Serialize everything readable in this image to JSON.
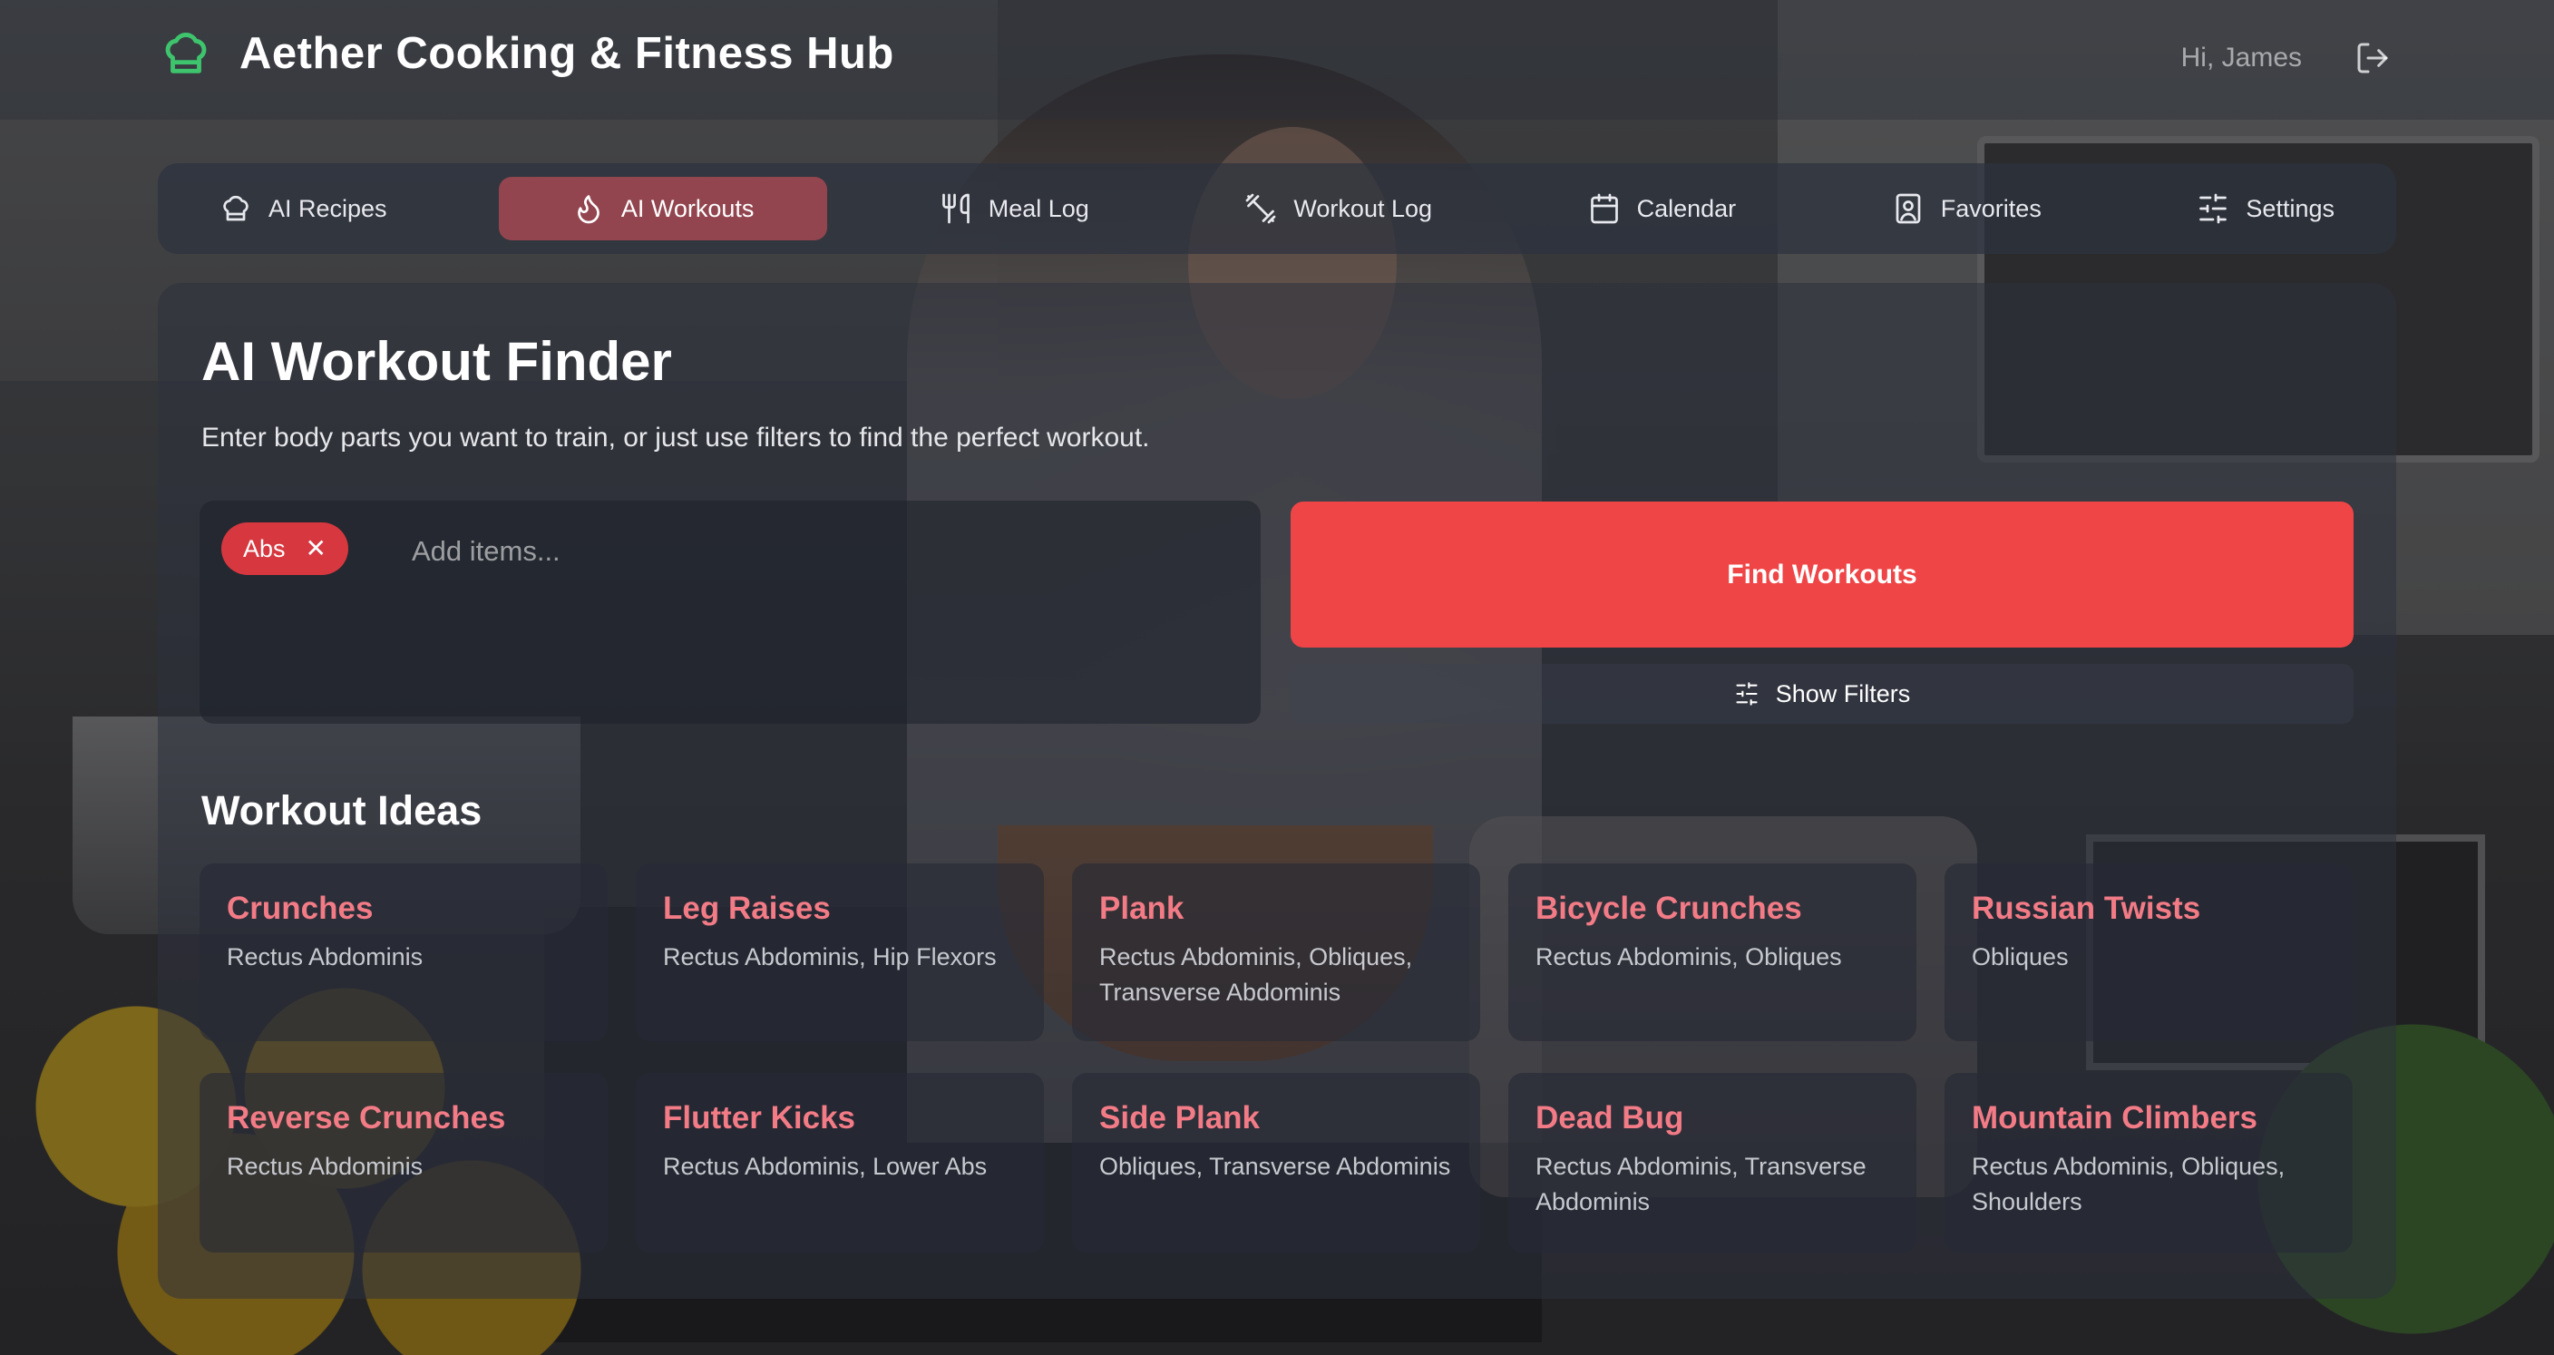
{
  "app": {
    "title": "Aether Cooking & Fitness Hub",
    "greeting": "Hi, James"
  },
  "nav": {
    "items": [
      {
        "label": "AI Recipes",
        "icon": "chef-hat-icon"
      },
      {
        "label": "AI Workouts",
        "icon": "flame-icon",
        "active": true
      },
      {
        "label": "Meal Log",
        "icon": "utensils-icon"
      },
      {
        "label": "Workout Log",
        "icon": "dumbbell-icon"
      },
      {
        "label": "Calendar",
        "icon": "calendar-icon"
      },
      {
        "label": "Favorites",
        "icon": "bookmark-icon"
      },
      {
        "label": "Settings",
        "icon": "sliders-icon"
      }
    ]
  },
  "finder": {
    "title": "AI Workout Finder",
    "subtitle": "Enter body parts you want to train, or just use filters to find the perfect workout.",
    "tags": [
      "Abs"
    ],
    "tag_remove_glyph": "✕",
    "input_placeholder": "Add items...",
    "find_button": "Find Workouts",
    "filters_button": "Show Filters"
  },
  "ideas": {
    "title": "Workout Ideas",
    "cards": [
      {
        "name": "Crunches",
        "muscles": "Rectus Abdominis"
      },
      {
        "name": "Leg Raises",
        "muscles": "Rectus Abdominis, Hip Flexors"
      },
      {
        "name": "Plank",
        "muscles": "Rectus Abdominis, Obliques, Transverse Abdominis"
      },
      {
        "name": "Bicycle Crunches",
        "muscles": "Rectus Abdominis, Obliques"
      },
      {
        "name": "Russian Twists",
        "muscles": "Obliques"
      },
      {
        "name": "Reverse Crunches",
        "muscles": "Rectus Abdominis"
      },
      {
        "name": "Flutter Kicks",
        "muscles": "Rectus Abdominis, Lower Abs"
      },
      {
        "name": "Side Plank",
        "muscles": "Obliques, Transverse Abdominis"
      },
      {
        "name": "Dead Bug",
        "muscles": "Rectus Abdominis, Transverse Abdominis"
      },
      {
        "name": "Mountain Climbers",
        "muscles": "Rectus Abdominis, Obliques, Shoulders"
      }
    ]
  },
  "colors": {
    "brand_green": "#3ec46d",
    "accent_red": "#ef4547",
    "chip_red": "#d7373f",
    "card_title": "#f27b86"
  }
}
